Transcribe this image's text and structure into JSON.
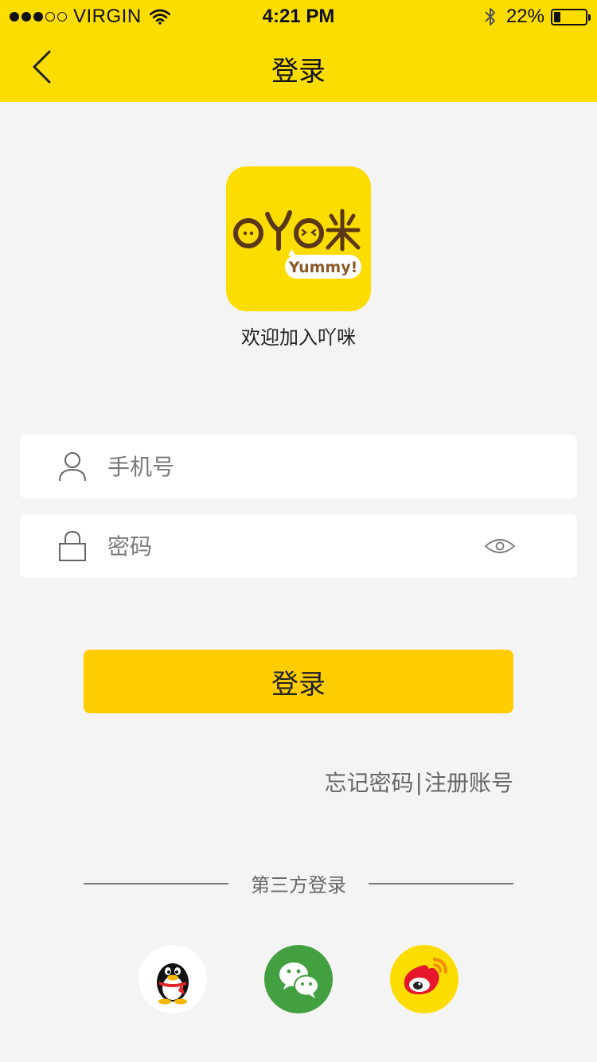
{
  "status_bar": {
    "carrier": "VIRGIN",
    "signal_filled": 3,
    "signal_total": 5,
    "time": "4:21 PM",
    "battery_text": "22%",
    "battery_level": 0.22
  },
  "nav": {
    "title": "登录"
  },
  "logo": {
    "wordmark": "吖咪",
    "tagline": "Yummy!"
  },
  "welcome_text": "欢迎加入吖咪",
  "form": {
    "phone_placeholder": "手机号",
    "password_placeholder": "密码",
    "login_label": "登录"
  },
  "links": {
    "forgot": "忘记密码",
    "separator": "|",
    "register": "注册账号"
  },
  "third_party": {
    "label": "第三方登录"
  },
  "colors": {
    "brand_yellow": "#fddc00",
    "button_yellow": "#ffcc00",
    "wechat_green": "#42a040",
    "background": "#f4f4f4"
  }
}
